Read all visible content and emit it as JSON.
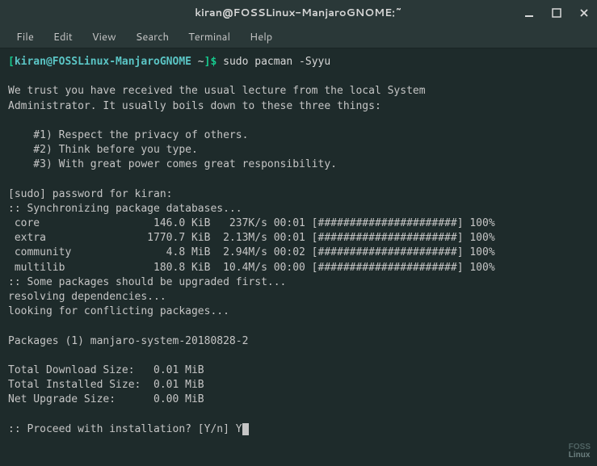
{
  "titlebar": {
    "title": "kiran@FOSSLinux-ManjaroGNOME:~"
  },
  "menubar": {
    "file": "File",
    "edit": "Edit",
    "view": "View",
    "search": "Search",
    "terminal": "Terminal",
    "help": "Help"
  },
  "prompt": {
    "bracket_open": "[",
    "user_host": "kiran@FOSSLinux-ManjaroGNOME",
    "path": " ~",
    "bracket_close": "]$ ",
    "command": "sudo pacman -Syyu"
  },
  "lecture": {
    "line1": "We trust you have received the usual lecture from the local System",
    "line2": "Administrator. It usually boils down to these three things:",
    "rule1": "    #1) Respect the privacy of others.",
    "rule2": "    #2) Think before you type.",
    "rule3": "    #3) With great power comes great responsibility."
  },
  "sudo_prompt": "[sudo] password for kiran: ",
  "sync_header": ":: Synchronizing package databases...",
  "repos": {
    "core": " core                  146.0 KiB   237K/s 00:01 [######################] 100%",
    "extra": " extra                1770.7 KiB  2.13M/s 00:01 [######################] 100%",
    "community": " community               4.8 MiB  2.94M/s 00:02 [######################] 100%",
    "multilib": " multilib              180.8 KiB  10.4M/s 00:00 [######################] 100%"
  },
  "upgrade_msg": ":: Some packages should be upgraded first...",
  "resolving": "resolving dependencies...",
  "conflicts": "looking for conflicting packages...",
  "packages": "Packages (1) manjaro-system-20180828-2",
  "sizes": {
    "download": "Total Download Size:   0.01 MiB",
    "installed": "Total Installed Size:  0.01 MiB",
    "upgrade": "Net Upgrade Size:      0.00 MiB"
  },
  "proceed": ":: Proceed with installation? [Y/n] ",
  "input": "Y",
  "watermark": {
    "line1": "FOSS",
    "line2": "Linux"
  }
}
